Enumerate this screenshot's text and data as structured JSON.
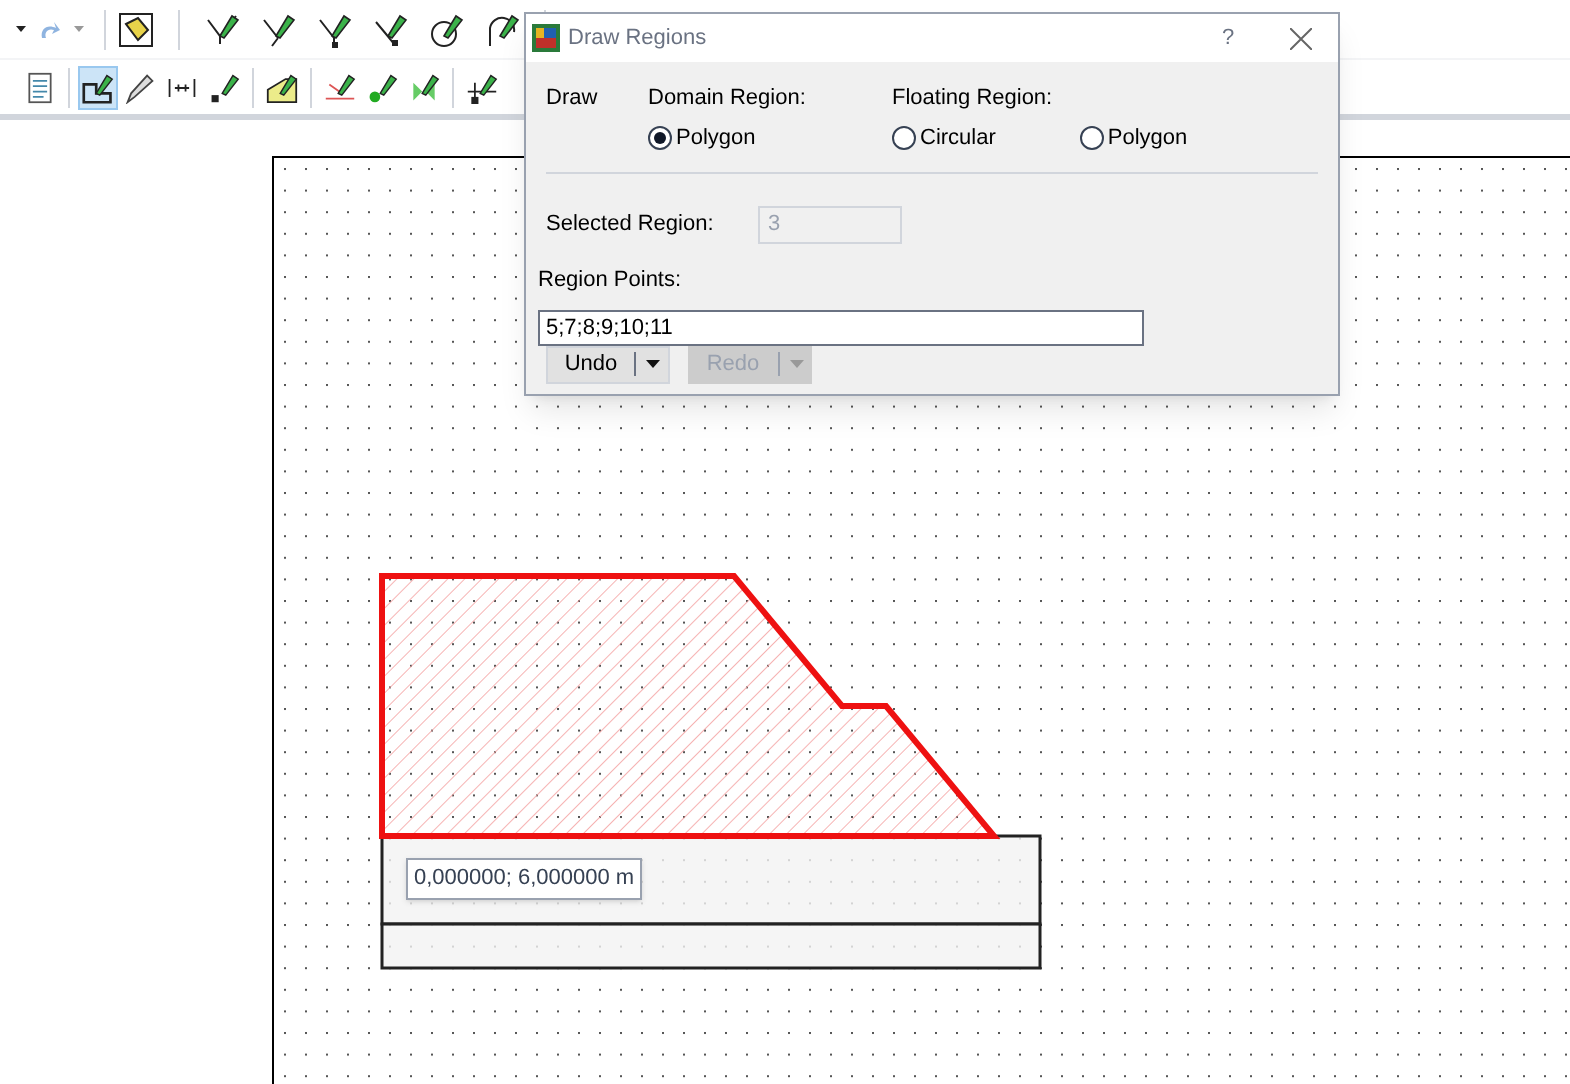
{
  "drawing_toolbar": [
    {
      "selected": false
    },
    {
      "selected": true
    },
    {
      "selected": false
    },
    {
      "selected": false
    },
    {
      "selected": false
    },
    {
      "selected": false
    },
    {
      "selected": false
    },
    {
      "selected": false
    },
    {
      "selected": false
    },
    {
      "selected": false
    }
  ],
  "dialog": {
    "title": "Draw Regions",
    "help": "?",
    "draw_label": "Draw",
    "domain_region": {
      "label": "Domain Region:",
      "options": [
        {
          "label": "Polygon",
          "selected": true
        }
      ]
    },
    "floating_region": {
      "label": "Floating Region:",
      "options": [
        {
          "label": "Circular",
          "selected": false
        },
        {
          "label": "Polygon",
          "selected": false
        }
      ]
    },
    "selected_region": {
      "label": "Selected Region:",
      "value": "3",
      "disabled": true
    },
    "region_points": {
      "label": "Region Points:",
      "value": "5;7;8;9;10;11"
    },
    "buttons": [
      {
        "label": "Undo",
        "disabled": false
      },
      {
        "label": "Redo",
        "disabled": true
      }
    ]
  },
  "canvas": {
    "tooltip": "0,000000; 6,000000 m"
  }
}
